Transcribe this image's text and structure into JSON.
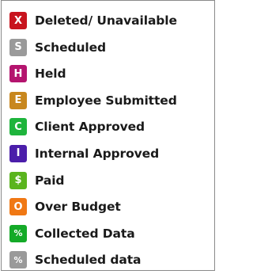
{
  "legend": {
    "items": [
      {
        "symbol": "X",
        "label": "Deleted/ Unavailable",
        "color": "#c8141e",
        "icon": "x-badge-icon"
      },
      {
        "symbol": "S",
        "label": "Scheduled",
        "color": "#9a9a9a",
        "icon": "s-badge-icon"
      },
      {
        "symbol": "H",
        "label": "Held",
        "color": "#b4146e",
        "icon": "h-badge-icon"
      },
      {
        "symbol": "E",
        "label": "Employee Submitted",
        "color": "#c8871e",
        "icon": "e-badge-icon"
      },
      {
        "symbol": "C",
        "label": "Client Approved",
        "color": "#1eb43c",
        "icon": "c-badge-icon"
      },
      {
        "symbol": "I",
        "label": "Internal Approved",
        "color": "#4b1eaa",
        "icon": "i-badge-icon"
      },
      {
        "symbol": "$",
        "label": "Paid",
        "color": "#5ab41e",
        "icon": "dollar-badge-icon"
      },
      {
        "symbol": "O",
        "label": "Over Budget",
        "color": "#f07814",
        "icon": "o-badge-icon"
      },
      {
        "symbol": "%",
        "label": "Collected Data",
        "color": "#14aa28",
        "icon": "percent-badge-icon"
      },
      {
        "symbol": "%",
        "label": "Scheduled data",
        "color": "#9a9a9a",
        "icon": "percent-badge-icon"
      }
    ]
  }
}
